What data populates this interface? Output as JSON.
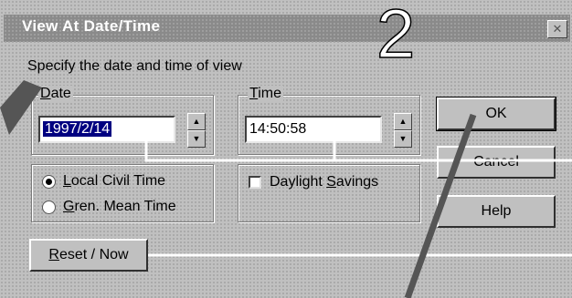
{
  "window": {
    "title": "View At Date/Time",
    "close_glyph": "✕"
  },
  "annotation": {
    "step_number": "2"
  },
  "instruction": "Specify the date and time of view",
  "date_group": {
    "label_prefix": "",
    "label_u": "D",
    "label_rest": "ate",
    "value": "1997/2/14"
  },
  "time_group": {
    "label_u": "T",
    "label_rest": "ime",
    "value": "14:50:58"
  },
  "spinner": {
    "up": "▲",
    "down": "▼"
  },
  "timezone": {
    "local": {
      "u": "L",
      "rest": "ocal Civil Time",
      "selected": true
    },
    "gmt": {
      "u": "G",
      "rest": "ren. Mean Time",
      "selected": false
    }
  },
  "daylight": {
    "before": "Daylight ",
    "u": "S",
    "rest": "avings",
    "checked": false
  },
  "buttons": {
    "ok": "OK",
    "cancel": "Cancel",
    "help": "Help",
    "reset_u": "R",
    "reset_rest": "eset / Now"
  }
}
